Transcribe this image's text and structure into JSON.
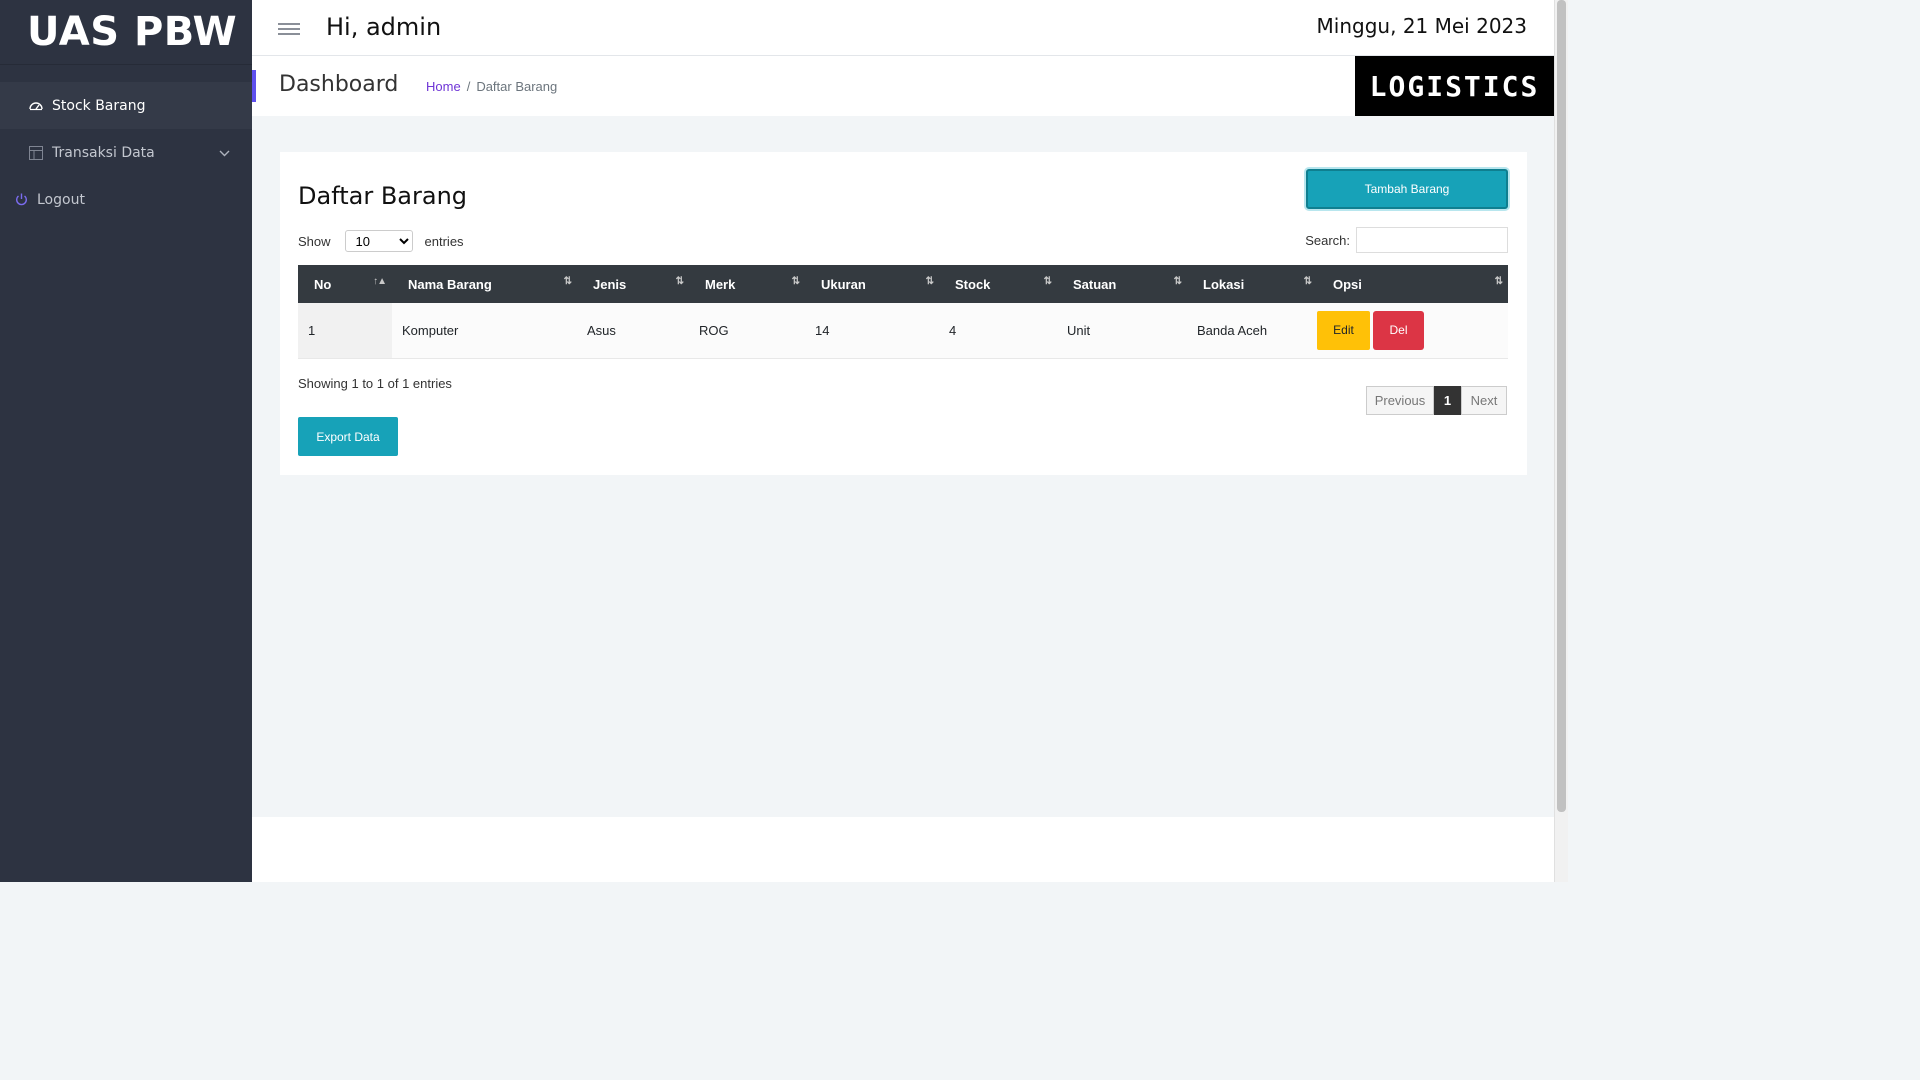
{
  "sidebar": {
    "brand": "UAS PBW",
    "items": [
      {
        "label": "Stock Barang",
        "icon": "dashboard-icon"
      },
      {
        "label": "Transaksi Data",
        "icon": "table-icon"
      },
      {
        "label": "Logout",
        "icon": "power-icon"
      }
    ]
  },
  "topbar": {
    "greeting": "Hi, admin",
    "date": "Minggu, 21 Mei 2023"
  },
  "header": {
    "title": "Dashboard",
    "breadcrumb": {
      "home": "Home",
      "separator": "/",
      "current": "Daftar Barang"
    },
    "logo": "LOGISTICS"
  },
  "card": {
    "title": "Daftar Barang",
    "add_button": "Tambah Barang",
    "show_label": "Show",
    "entries_value": "10",
    "entries_label": "entries",
    "search_label": "Search:",
    "search_value": "",
    "columns": [
      "No",
      "Nama Barang",
      "Jenis",
      "Merk",
      "Ukuran",
      "Stock",
      "Satuan",
      "Lokasi",
      "Opsi"
    ],
    "rows": [
      {
        "no": "1",
        "nama": "Komputer",
        "jenis": "Asus",
        "merk": "ROG",
        "ukuran": "14",
        "stock": "4",
        "satuan": "Unit",
        "lokasi": "Banda Aceh"
      }
    ],
    "edit_label": "Edit",
    "del_label": "Del",
    "info": "Showing 1 to 1 of 1 entries",
    "pager": {
      "previous": "Previous",
      "current": "1",
      "next": "Next"
    },
    "export_button": "Export Data"
  },
  "colors": {
    "sidebar_bg": "#2d3341",
    "accent": "#5e50ee",
    "primary": "#17a2b8",
    "warning": "#ffc107",
    "danger": "#dc3545",
    "table_header": "#343a40"
  }
}
